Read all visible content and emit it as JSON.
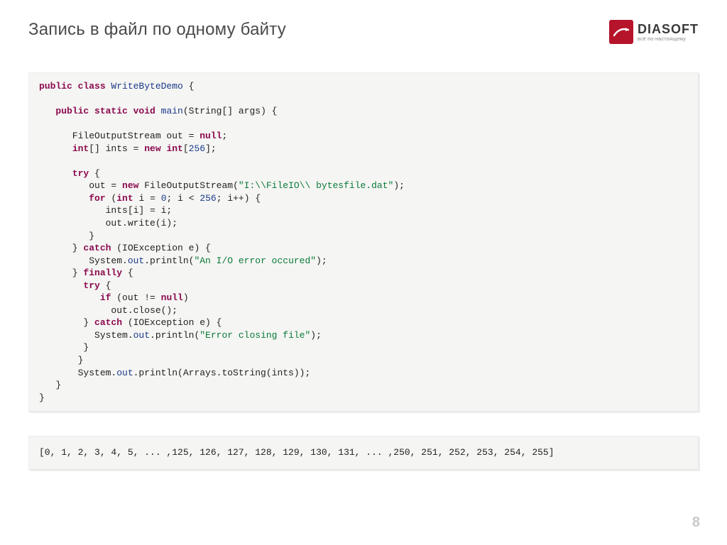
{
  "header": {
    "title": "Запись в файл по одному байту",
    "logo": {
      "brand": "DIASOFT",
      "tagline": "всё по-настоящему"
    }
  },
  "code": {
    "tokens": [
      {
        "t": "kw",
        "v": "public class "
      },
      {
        "t": "cls",
        "v": "WriteByteDemo"
      },
      {
        "t": "plain",
        "v": " {\n\n   "
      },
      {
        "t": "kw",
        "v": "public static void "
      },
      {
        "t": "cls",
        "v": "main"
      },
      {
        "t": "plain",
        "v": "(String[] args) {\n\n      FileOutputStream out = "
      },
      {
        "t": "kw",
        "v": "null"
      },
      {
        "t": "plain",
        "v": ";\n      "
      },
      {
        "t": "kw",
        "v": "int"
      },
      {
        "t": "plain",
        "v": "[] ints = "
      },
      {
        "t": "kw",
        "v": "new int"
      },
      {
        "t": "plain",
        "v": "["
      },
      {
        "t": "cls",
        "v": "256"
      },
      {
        "t": "plain",
        "v": "];\n\n      "
      },
      {
        "t": "kw",
        "v": "try "
      },
      {
        "t": "plain",
        "v": "{\n         out = "
      },
      {
        "t": "kw",
        "v": "new "
      },
      {
        "t": "plain",
        "v": "FileOutputStream("
      },
      {
        "t": "str",
        "v": "\"I:\\\\FileIO\\\\ bytesfile.dat\""
      },
      {
        "t": "plain",
        "v": ");\n         "
      },
      {
        "t": "kw",
        "v": "for "
      },
      {
        "t": "plain",
        "v": "("
      },
      {
        "t": "kw",
        "v": "int "
      },
      {
        "t": "plain",
        "v": "i = "
      },
      {
        "t": "cls",
        "v": "0"
      },
      {
        "t": "plain",
        "v": "; i < "
      },
      {
        "t": "cls",
        "v": "256"
      },
      {
        "t": "plain",
        "v": "; i++) {\n            ints[i] = i;\n            out.write(i);\n         }\n      } "
      },
      {
        "t": "kw",
        "v": "catch "
      },
      {
        "t": "plain",
        "v": "(IOException e) {\n         System."
      },
      {
        "t": "fld",
        "v": "out"
      },
      {
        "t": "plain",
        "v": ".println("
      },
      {
        "t": "str",
        "v": "\"An I/O error occured\""
      },
      {
        "t": "plain",
        "v": ");\n      } "
      },
      {
        "t": "kw",
        "v": "finally "
      },
      {
        "t": "plain",
        "v": "{\n        "
      },
      {
        "t": "kw",
        "v": "try "
      },
      {
        "t": "plain",
        "v": "{\n           "
      },
      {
        "t": "kw",
        "v": "if "
      },
      {
        "t": "plain",
        "v": "(out != "
      },
      {
        "t": "kw",
        "v": "null"
      },
      {
        "t": "plain",
        "v": ")\n             out.close();\n        } "
      },
      {
        "t": "kw",
        "v": "catch "
      },
      {
        "t": "plain",
        "v": "(IOException e) {\n          System."
      },
      {
        "t": "fld",
        "v": "out"
      },
      {
        "t": "plain",
        "v": ".println("
      },
      {
        "t": "str",
        "v": "\"Error closing file\""
      },
      {
        "t": "plain",
        "v": ");\n        }\n       }\n       System."
      },
      {
        "t": "fld",
        "v": "out"
      },
      {
        "t": "plain",
        "v": ".println(Arrays.toString(ints));\n   }\n}"
      }
    ]
  },
  "output": {
    "text": "[0, 1, 2, 3, 4, 5, ... ,125, 126, 127, 128, 129, 130, 131, ... ,250, 251, 252, 253, 254, 255]"
  },
  "footer": {
    "page": "8"
  }
}
